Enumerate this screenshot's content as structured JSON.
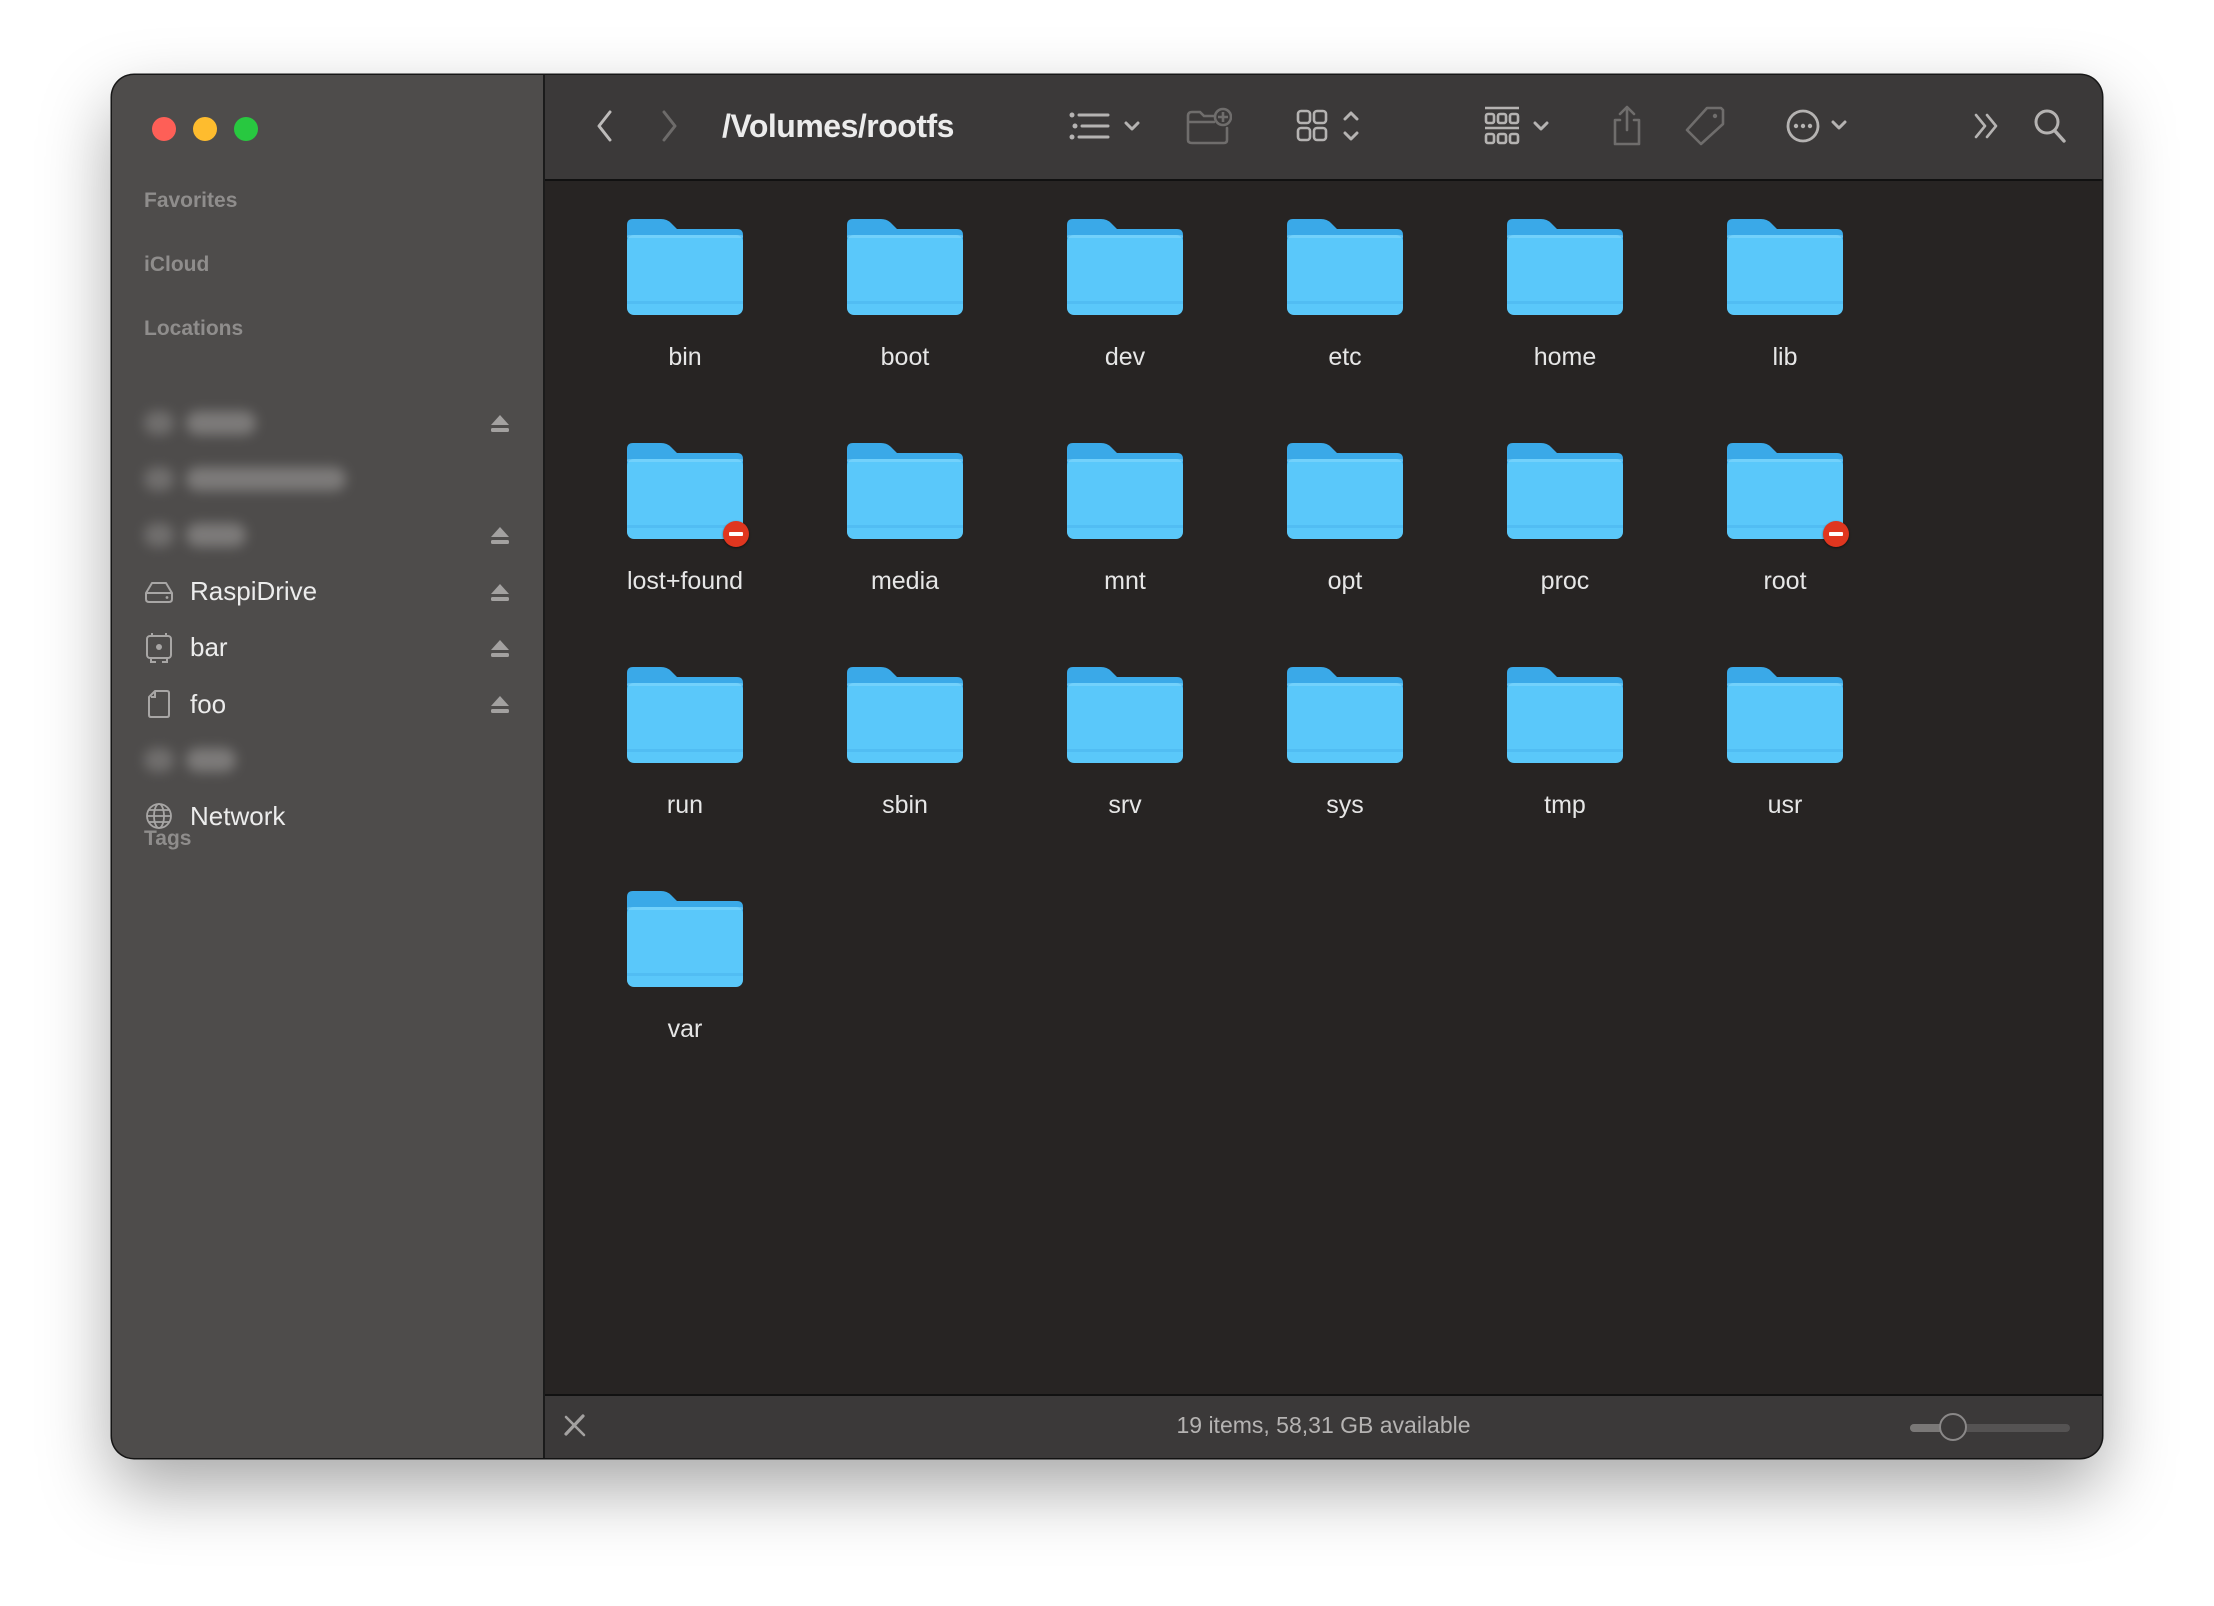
{
  "window": {
    "title": "/Volumes/rootfs",
    "traffic_lights": [
      "close",
      "minimize",
      "zoom"
    ]
  },
  "sidebar": {
    "sections": {
      "favorites": "Favorites",
      "icloud": "iCloud",
      "locations": "Locations",
      "tags": "Tags"
    },
    "locations": [
      {
        "label": "",
        "redacted": true,
        "icon": "disk-icon",
        "ejectable": true
      },
      {
        "label": "",
        "redacted": true,
        "icon": "computer-icon",
        "ejectable": false
      },
      {
        "label": "",
        "redacted": true,
        "icon": "disk-icon",
        "ejectable": true
      },
      {
        "label": "RaspiDrive",
        "redacted": false,
        "icon": "external-drive-icon",
        "ejectable": true
      },
      {
        "label": "bar",
        "redacted": false,
        "icon": "mac-disk-icon",
        "ejectable": true
      },
      {
        "label": "foo",
        "redacted": false,
        "icon": "sd-card-icon",
        "ejectable": true
      },
      {
        "label": "",
        "redacted": true,
        "icon": "disk-icon",
        "ejectable": false
      },
      {
        "label": "Network",
        "redacted": false,
        "icon": "globe-icon",
        "ejectable": false
      }
    ]
  },
  "toolbar": {
    "back": "chevron-left-icon",
    "forward": "chevron-right-icon",
    "list_view": "list-icon",
    "new_folder": "folder-plus-icon",
    "view_mode": "icon-grid-icon",
    "group": "group-icon",
    "share": "share-icon",
    "tag": "tag-icon",
    "more": "ellipsis-circle-icon",
    "overflow": "double-chevron-icon",
    "search": "search-icon"
  },
  "content": {
    "items": [
      {
        "name": "bin",
        "restricted": false
      },
      {
        "name": "boot",
        "restricted": false
      },
      {
        "name": "dev",
        "restricted": false
      },
      {
        "name": "etc",
        "restricted": false
      },
      {
        "name": "home",
        "restricted": false
      },
      {
        "name": "lib",
        "restricted": false
      },
      {
        "name": "lost+found",
        "restricted": true
      },
      {
        "name": "media",
        "restricted": false
      },
      {
        "name": "mnt",
        "restricted": false
      },
      {
        "name": "opt",
        "restricted": false
      },
      {
        "name": "proc",
        "restricted": false
      },
      {
        "name": "root",
        "restricted": true
      },
      {
        "name": "run",
        "restricted": false
      },
      {
        "name": "sbin",
        "restricted": false
      },
      {
        "name": "srv",
        "restricted": false
      },
      {
        "name": "sys",
        "restricted": false
      },
      {
        "name": "tmp",
        "restricted": false
      },
      {
        "name": "usr",
        "restricted": false
      },
      {
        "name": "var",
        "restricted": false
      }
    ]
  },
  "statusbar": {
    "text": "19 items, 58,31 GB available",
    "read_only_icon": "pencil-slash-icon",
    "icon_size_slider": 0.27
  },
  "colors": {
    "folder": "#5ac8fa",
    "folder_dark": "#3aa9e8",
    "restricted_badge": "#e0361f"
  }
}
